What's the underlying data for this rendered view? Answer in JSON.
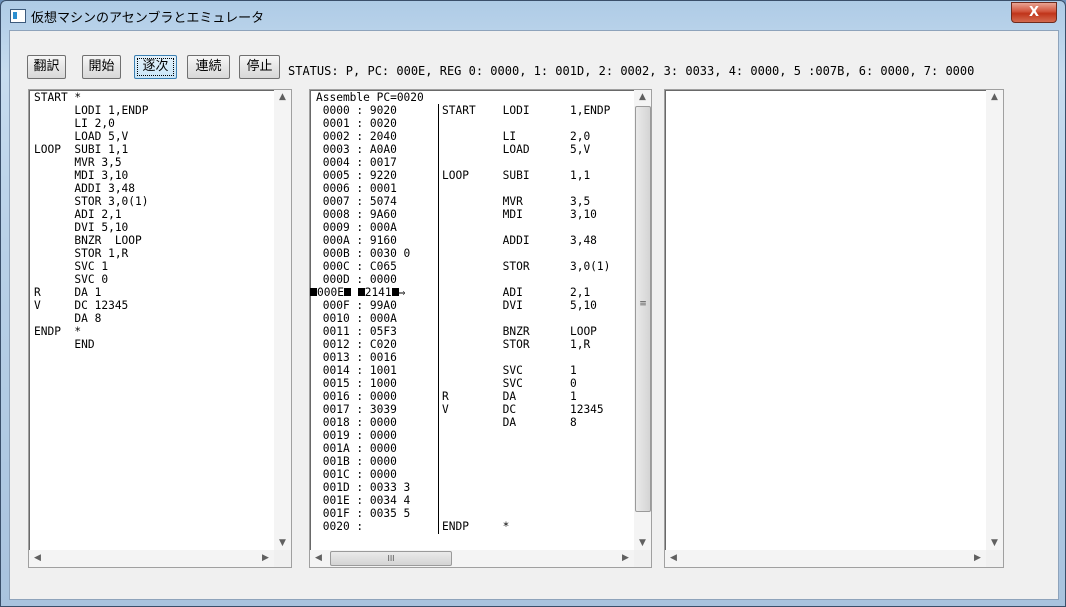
{
  "window": {
    "title": "仮想マシンのアセンブラとエミュレータ",
    "close_label": "X"
  },
  "toolbar": {
    "translate_label": "翻訳",
    "start_label": "開始",
    "step_label": "逐次",
    "continuous_label": "連続",
    "stop_label": "停止"
  },
  "status": "STATUS: P, PC: 000E, REG 0: 0000, 1: 001D, 2: 0002, 3: 0033, 4: 0000, 5 :007B, 6: 0000, 7: 0000",
  "source": {
    "lines": [
      "START *",
      "      LODI 1,ENDP",
      "      LI 2,0",
      "      LOAD 5,V",
      "LOOP  SUBI 1,1",
      "      MVR 3,5",
      "      MDI 3,10",
      "      ADDI 3,48",
      "      STOR 3,0(1)",
      "      ADI 2,1",
      "      DVI 5,10",
      "      BNZR  LOOP",
      "      STOR 1,R",
      "      SVC 1",
      "      SVC 0",
      "R     DA 1",
      "V     DC 12345",
      "      DA 8",
      "ENDP  *",
      "      END"
    ]
  },
  "assemble": {
    "header": "Assemble PC=0020",
    "memory": [
      "0000 : 9020",
      "0001 : 0020",
      "0002 : 2040",
      "0003 : A0A0",
      "0004 : 0017",
      "0005 : 9220",
      "0006 : 0001",
      "0007 : 5074",
      "0008 : 9A60",
      "0009 : 000A",
      "000A : 9160",
      "000B : 0030 0",
      "000C : C065",
      "000D : 0000",
      "000E : 2141",
      "000F : 99A0",
      "0010 : 000A",
      "0011 : 05F3",
      "0012 : C020",
      "0013 : 0016",
      "0014 : 1001",
      "0015 : 1000",
      "0016 : 0000",
      "0017 : 3039",
      "0018 : 0000",
      "0019 : 0000",
      "001A : 0000",
      "001B : 0000",
      "001C : 0000",
      "001D : 0033 3",
      "001E : 0034 4",
      "001F : 0035 5",
      "0020 :"
    ],
    "current_addr": "000E",
    "current_word": "2141",
    "current_arrow": "⇒",
    "listing": [
      "START    LODI      1,ENDP",
      "",
      "         LI        2,0",
      "         LOAD      5,V",
      "",
      "LOOP     SUBI      1,1",
      "",
      "         MVR       3,5",
      "         MDI       3,10",
      "",
      "         ADDI      3,48",
      "",
      "         STOR      3,0(1)",
      "",
      "         ADI       2,1",
      "         DVI       5,10",
      "",
      "         BNZR      LOOP",
      "         STOR      1,R",
      "",
      "         SVC       1",
      "         SVC       0",
      "R        DA        1",
      "V        DC        12345",
      "         DA        8",
      "",
      "",
      "",
      "",
      "",
      "",
      "",
      "ENDP     *"
    ]
  },
  "scroll": {
    "h_thumb_grip": "III",
    "v_thumb_grip": "≡"
  }
}
